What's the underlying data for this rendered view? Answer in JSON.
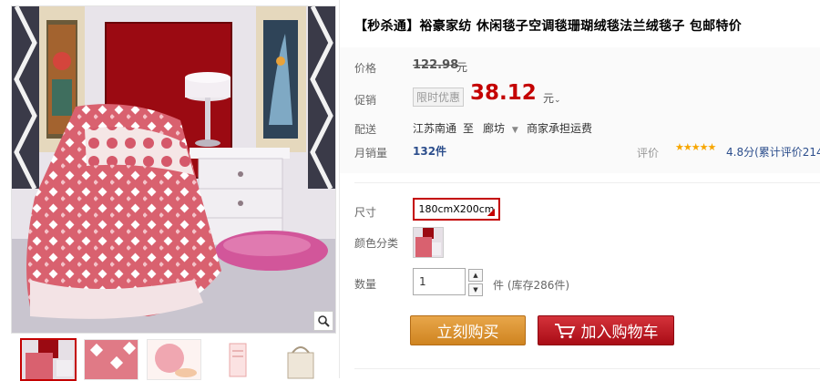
{
  "product": {
    "title": "【秒杀通】裕豪家纺 休闲毯子空调毯珊瑚绒毯法兰绒毯子 包邮特价"
  },
  "price": {
    "label": "价格",
    "original": "122.98",
    "unit": "元"
  },
  "promo": {
    "label": "促销",
    "badge": "限时优惠",
    "price": "38.12",
    "unit": "元"
  },
  "shipping": {
    "label": "配送",
    "from": "江苏南通",
    "to_word": "至",
    "destination": "廊坊",
    "note": "商家承担运费"
  },
  "sales": {
    "label": "月销量",
    "value": "132件"
  },
  "reviews": {
    "label": "评价",
    "stars": "★★★★★",
    "score": "4.8分(累计评价214"
  },
  "options": {
    "size_label": "尺寸",
    "size_value": "180cmX200cm",
    "color_label": "颜色分类",
    "qty_label": "数量",
    "qty_value": "1",
    "stock": "件 (库存286件)"
  },
  "actions": {
    "buy_now": "立刻购买",
    "add_cart": "加入购物车"
  },
  "icons": {
    "zoom": "magnifier-icon",
    "cart": "shopping-cart-icon",
    "qty_up": "triangle-up-icon",
    "qty_down": "triangle-down-icon",
    "dropdown": "chevron-down-icon"
  },
  "colors": {
    "price_red": "#c40000",
    "buy_orange": "#d98c2a",
    "cart_red": "#b8101b",
    "link_blue": "#2c4e8c",
    "star": "#f7a600"
  }
}
